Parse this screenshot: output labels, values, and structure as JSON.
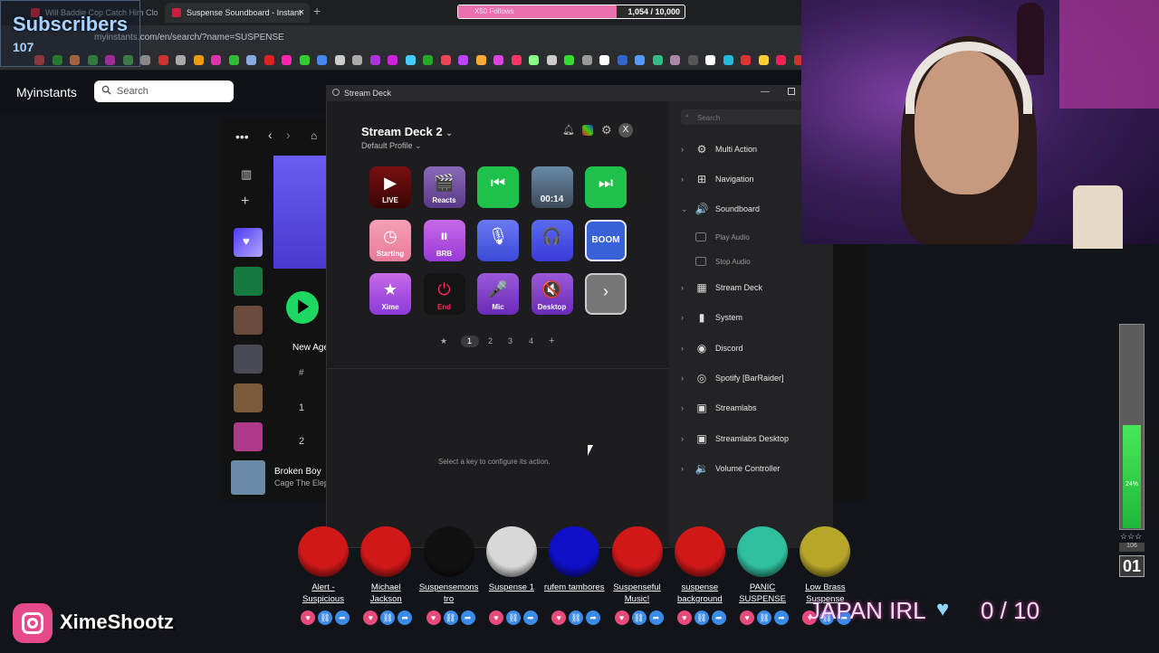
{
  "browser": {
    "tabs": [
      {
        "label": "Will Baddie Cop Catch Him Clo",
        "active": false
      },
      {
        "label": "Suspense Soundboard - Instant",
        "active": true
      }
    ],
    "url": "myinstants.com/en/search/?name=SUSPENSE"
  },
  "overlay": {
    "subscribers_label": "Subscribers",
    "subscribers_count": "107",
    "goal_label": "X50 Follows",
    "goal_count": "1,054 / 10,000",
    "goal_progress": 0.7,
    "instagram_handle": "XimeShootz",
    "japan_label": "JAPAN IRL",
    "japan_count": "0 / 10",
    "meter_pct": "24%",
    "meter_level": 0.24,
    "meter_stars": "☆☆☆",
    "meter_num": "106",
    "meter_big": "01"
  },
  "myinstants": {
    "logo": "Myinstants",
    "search_placeholder": "Search"
  },
  "spotify": {
    "section_label": "New Age",
    "row1": "1",
    "row2": "2",
    "hash": "#",
    "now_playing_title": "Broken Boy",
    "now_playing_artist": "Cage The Elephant"
  },
  "streamdeck": {
    "window_title": "Stream Deck",
    "device_name": "Stream Deck 2",
    "profile": "Default Profile",
    "close_label": "X",
    "keys": [
      {
        "label": "LIVE",
        "glyph": "▶"
      },
      {
        "label": "Reacts",
        "glyph": "🎬"
      },
      {
        "label": "",
        "glyph": "⏮"
      },
      {
        "label": "00:14",
        "glyph": ""
      },
      {
        "label": "",
        "glyph": "⏭"
      },
      {
        "label": "Starting",
        "glyph": "◷"
      },
      {
        "label": "BRB",
        "glyph": "⏸"
      },
      {
        "label": "",
        "glyph": "🎙"
      },
      {
        "label": "",
        "glyph": "🎧"
      },
      {
        "label": "BOOM",
        "glyph": ""
      },
      {
        "label": "Xime",
        "glyph": "★"
      },
      {
        "label": "End",
        "glyph": "⏻"
      },
      {
        "label": "Mic",
        "glyph": "🎤"
      },
      {
        "label": "Desktop",
        "glyph": "🔇"
      },
      {
        "label": "",
        "glyph": "›"
      }
    ],
    "pages": [
      "1",
      "2",
      "3",
      "4"
    ],
    "add_page": "+",
    "empty_state": "Select a key to configure its action.",
    "search_placeholder": "Search",
    "categories": [
      {
        "label": "Multi Action",
        "icon": "⚙"
      },
      {
        "label": "Navigation",
        "icon": "⊞"
      },
      {
        "label": "Soundboard",
        "icon": "🔊",
        "expanded": true
      },
      {
        "label": "Stream Deck",
        "icon": "▦"
      },
      {
        "label": "System",
        "icon": "▮"
      },
      {
        "label": "Discord",
        "icon": "◉"
      },
      {
        "label": "Spotify [BarRaider]",
        "icon": "◎"
      },
      {
        "label": "Streamlabs",
        "icon": "▣"
      },
      {
        "label": "Streamlabs Desktop",
        "icon": "▣"
      },
      {
        "label": "Volume Controller",
        "icon": "🔉"
      }
    ],
    "sub_actions": [
      "Play Audio",
      "Stop Audio"
    ]
  },
  "sounds": [
    {
      "label": "Alert - Suspicious",
      "color": "#d01818"
    },
    {
      "label": "Michael Jackson",
      "color": "#d01818"
    },
    {
      "label": "Suspensemons tro",
      "color": "#111111"
    },
    {
      "label": "Suspense 1",
      "color": "#d8d8d8"
    },
    {
      "label": "rufem tambores",
      "color": "#1010c8"
    },
    {
      "label": "Suspenseful Music!",
      "color": "#d01818"
    },
    {
      "label": "suspense background",
      "color": "#d01818"
    },
    {
      "label": "PANIC SUSPENSE",
      "color": "#2fbf9f"
    },
    {
      "label": "Low Brass Suspense",
      "color": "#b8a62a"
    }
  ]
}
